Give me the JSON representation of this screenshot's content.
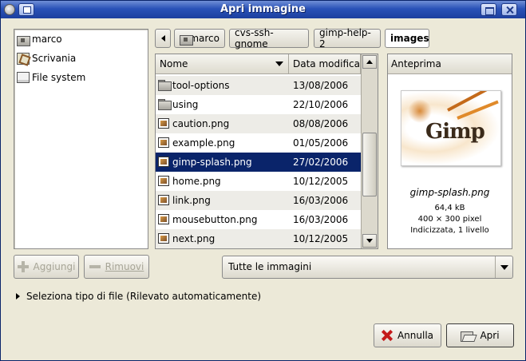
{
  "window": {
    "title": "Apri immagine"
  },
  "places": [
    {
      "label": "marco",
      "icon": "home-folder-icon"
    },
    {
      "label": "Scrivania",
      "icon": "desktop-icon"
    },
    {
      "label": "File system",
      "icon": "filesystem-icon"
    }
  ],
  "pathbar": {
    "crumbs": [
      "marco",
      "cvs-ssh-gnome",
      "gimp-help-2",
      "images"
    ],
    "active": "images"
  },
  "filelist": {
    "columns": {
      "name": "Nome",
      "date": "Data modifica"
    },
    "rows": [
      {
        "name": "tool-options",
        "date": "13/08/2006",
        "type": "folder"
      },
      {
        "name": "using",
        "date": "22/10/2006",
        "type": "folder"
      },
      {
        "name": "caution.png",
        "date": "08/08/2006",
        "type": "image"
      },
      {
        "name": "example.png",
        "date": "01/05/2006",
        "type": "image"
      },
      {
        "name": "gimp-splash.png",
        "date": "27/02/2006",
        "type": "image",
        "selected": true
      },
      {
        "name": "home.png",
        "date": "10/12/2005",
        "type": "image"
      },
      {
        "name": "link.png",
        "date": "16/03/2006",
        "type": "image"
      },
      {
        "name": "mousebutton.png",
        "date": "16/03/2006",
        "type": "image"
      },
      {
        "name": "next.png",
        "date": "10/12/2005",
        "type": "image"
      }
    ]
  },
  "preview": {
    "header": "Anteprima",
    "thumbnail_text": "Gimp",
    "filename": "gimp-splash.png",
    "size": "64,4 kB",
    "dimensions": "400 × 300 pixel",
    "info": "Indicizzata, 1 livello"
  },
  "buttons": {
    "add": "Aggiungi",
    "remove": "Rimuovi",
    "cancel": "Annulla",
    "open": "Apri"
  },
  "filter": {
    "selected": "Tutte le immagini"
  },
  "expander": {
    "label": "Seleziona tipo di file (Rilevato automaticamente)"
  }
}
